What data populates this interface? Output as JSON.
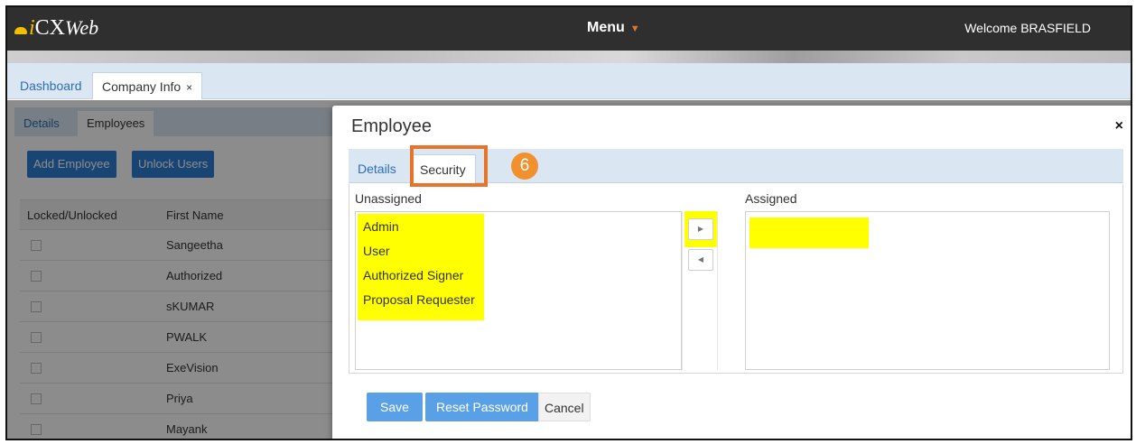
{
  "header": {
    "logo_i": "i",
    "logo_cx": "CX",
    "logo_web": "Web",
    "menu_label": "Menu",
    "welcome": "Welcome BRASFIELD"
  },
  "main_tabs": {
    "dashboard": "Dashboard",
    "company_info": "Company Info",
    "close_glyph": "×"
  },
  "page": {
    "tabs": {
      "details": "Details",
      "employees": "Employees"
    },
    "buttons": {
      "add_employee": "Add Employee",
      "unlock_users": "Unlock Users"
    },
    "columns": [
      "Locked/Unlocked",
      "First Name"
    ],
    "rows": [
      "Sangeetha",
      "Authorized",
      "sKUMAR",
      "PWALK",
      "ExeVision",
      "Priya",
      "Mayank"
    ]
  },
  "modal": {
    "title": "Employee",
    "close_glyph": "×",
    "tabs": {
      "details": "Details",
      "security": "Security"
    },
    "step_badge": "6",
    "unassigned_label": "Unassigned",
    "assigned_label": "Assigned",
    "unassigned_items": [
      "Admin",
      "User",
      "Authorized Signer",
      "Proposal Requester"
    ],
    "assigned_items": [],
    "arrow_right": "▶",
    "arrow_left": "◀",
    "buttons": {
      "save": "Save",
      "reset_password": "Reset Password",
      "cancel": "Cancel"
    }
  },
  "colors": {
    "highlight": "#ffff00",
    "callout": "#e8742a",
    "primary_button": "#2f7fd6",
    "tab_strip": "#dbe6f3"
  }
}
